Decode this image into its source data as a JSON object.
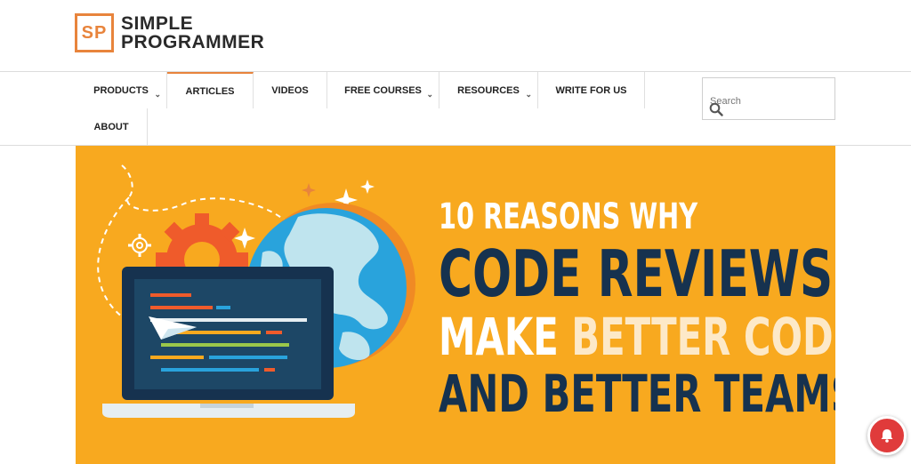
{
  "brand": {
    "initials": "SP",
    "line1": "SIMPLE",
    "line2": "PROGRAMMER",
    "accent": "#e8843c"
  },
  "nav": {
    "items": [
      {
        "label": "PRODUCTS",
        "has_dropdown": true
      },
      {
        "label": "ARTICLES",
        "active": true
      },
      {
        "label": "VIDEOS"
      },
      {
        "label": "FREE COURSES",
        "has_dropdown": true
      },
      {
        "label": "RESOURCES",
        "has_dropdown": true
      },
      {
        "label": "WRITE FOR US"
      },
      {
        "label": "ABOUT"
      }
    ]
  },
  "search": {
    "placeholder": "Search",
    "icon": "search-icon"
  },
  "hero": {
    "line1": "10 REASONS WHY",
    "line2": "CODE REVIEWS",
    "line3_a": "MAKE ",
    "line3_b": "BETTER CODE",
    "line4": "AND BETTER TEAMS",
    "background": "#f8a91f",
    "navy": "#16324f"
  },
  "notification": {
    "icon": "bell-icon",
    "color": "#e03b3b"
  }
}
